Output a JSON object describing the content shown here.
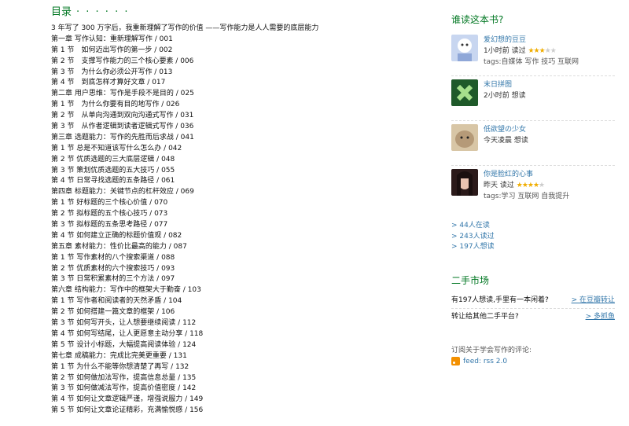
{
  "toc": {
    "title": "目录",
    "dots": "· · · · · ·",
    "lines": [
      "3 年写了 300 万字后，我重新理解了写作的价值 ——写作能力是人人需要的底层能力",
      "第一章 写作认知：重新理解写作 / 001",
      "第 1 节　如何迈出写作的第一步 / 002",
      "第 2 节　支撑写作能力的三个核心要素 / 006",
      "第 3 节　为什么你必须公开写作 / 013",
      "第 4 节　到底怎样才算好文章 / 017",
      "第二章 用户思维：写作是手段不是目的 / 025",
      "第 1 节　为什么你要有目的地写作 / 026",
      "第 2 节　从单向沟通到双向沟通式写作 / 031",
      "第 3 节　从作者逻辑到读者逻辑式写作 / 036",
      "第三章 选题能力：写作的先胜而后求战 / 041",
      "第 1 节 总是不知道该写什么怎么办 / 042",
      "第 2 节 优质选题的三大底层逻辑 / 048",
      "第 3 节 策划优质选题的五大技巧 / 055",
      "第 4 节 日常寻找选题的五条路径 / 061",
      "第四章 标题能力：关键节点的杠杆效应 / 069",
      "第 1 节 好标题的三个核心价值 / 070",
      "第 2 节 拟标题的五个核心技巧 / 073",
      "第 3 节 拟标题的五条思考路径 / 077",
      "第 4 节 如何建立正确的标题价值观 / 082",
      "第五章 素材能力：性价比最高的能力 / 087",
      "第 1 节 写作素材的八个搜索渠道 / 088",
      "第 2 节 优质素材的六个搜索技巧 / 093",
      "第 3 节 日常积累素材的三个方法 / 097",
      "第六章 结构能力：写作中的框架大于勤奋 / 103",
      "第 1 节 写作者和阅读者的天然矛盾 / 104",
      "第 2 节 如何搭建一篇文章的框架 / 106",
      "第 3 节 如何写开头，让人想要继续阅读 / 112",
      "第 4 节 如何写结尾，让人更愿意主动分享 / 118",
      "第 5 节 设计小标题，大幅提高阅读体验 / 124",
      "第七章 成稿能力：完成比完美更重要 / 131",
      "第 1 节 为什么不能等你想清楚了再写 / 132",
      "第 2 节 如何做加法写作，提高信息总量 / 135",
      "第 3 节 如何做减法写作，提高价值密度 / 142",
      "第 4 节 如何让文章逻辑严谨，增强说服力 / 149",
      "第 5 节 如何让文章论证精彩，充满愉悦感 / 156"
    ]
  },
  "sidebar": {
    "readers_title": "谁读这本书?",
    "readers": [
      {
        "name": "爱幻想的豆豆",
        "line": "1小时前 读过",
        "rating": 3,
        "tags": "tags:自媒体 写作 技巧 互联网"
      },
      {
        "name": "末日拼图",
        "line": "2小时前 想读",
        "rating": 0,
        "tags": ""
      },
      {
        "name": "低欲望の少女",
        "line": "今天凌晨 想读",
        "rating": 0,
        "tags": ""
      },
      {
        "name": "你是脸红的心事",
        "line": "昨天 读过",
        "rating": 4,
        "tags": "tags:学习 互联网 自我提升"
      }
    ],
    "links": [
      "> 44人在读",
      "> 243人读过",
      "> 197人想读"
    ],
    "market_title": "二手市场",
    "market_rows": [
      {
        "left": "有197人想读,手里有一本闲着?",
        "right": "> 在豆瓣转让"
      },
      {
        "left": "转让给其他二手平台?",
        "right": "> 多抓鱼"
      }
    ],
    "subscribe_text": "订阅关于学会写作的评论:",
    "feed_label": "feed: rss 2.0",
    "colors": {
      "accent_green": "#007722",
      "link_blue": "#3377aa",
      "star": "#f0ad00"
    }
  }
}
